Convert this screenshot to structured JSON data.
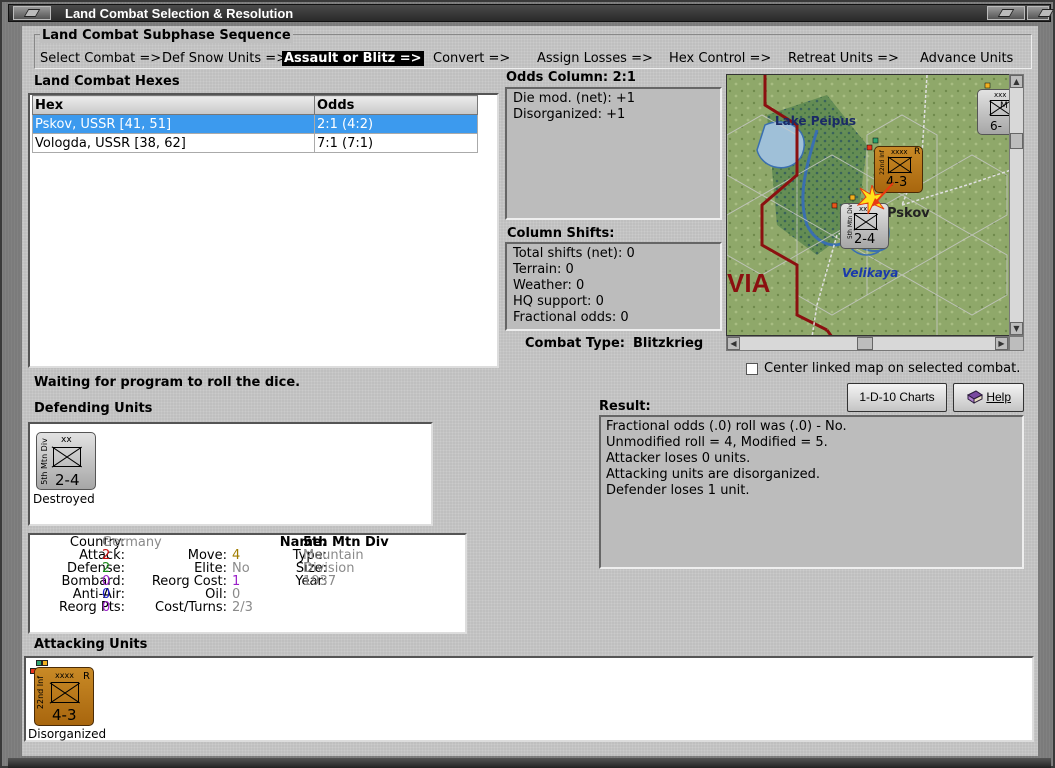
{
  "window": {
    "title": "Land Combat Selection & Resolution"
  },
  "sequence": {
    "title": "Land Combat Subphase Sequence",
    "steps": [
      "Select Combat =>",
      "Def Snow Units =>",
      "Assault or Blitz =>",
      "Convert =>",
      "Assign Losses =>",
      "Hex Control =>",
      "Retreat Units =>",
      "Advance Units"
    ],
    "active_index": 2
  },
  "hexes": {
    "title": "Land Combat Hexes",
    "columns": [
      "Hex",
      "Odds"
    ],
    "rows": [
      {
        "hex": "Pskov, USSR [41, 51]",
        "odds": "2:1 (4:2)",
        "selected": true
      },
      {
        "hex": "Vologda, USSR [38, 62]",
        "odds": "7:1 (7:1)",
        "selected": false
      }
    ]
  },
  "odds": {
    "title": "Odds Column: 2:1",
    "lines": [
      "Die mod. (net): +1",
      "Disorganized: +1"
    ]
  },
  "shifts": {
    "title": "Column Shifts:",
    "lines": [
      "Total shifts (net): 0",
      "Terrain: 0",
      "Weather: 0",
      "HQ support: 0",
      "Fractional odds: 0"
    ]
  },
  "combat_type": {
    "label": "Combat Type:",
    "value": "Blitzkrieg"
  },
  "map": {
    "labels": {
      "lake": "Lake Peipus",
      "city": "Pskov",
      "river": "Velikaya",
      "region": "VIA"
    },
    "counters": {
      "defender": {
        "size": "xx",
        "unit": "5th Mtn Div",
        "strength": "2-4"
      },
      "attacker": {
        "size": "xxxx",
        "unit": "22nd Inf",
        "flag": "R",
        "strength": "4-3"
      },
      "offmap": {
        "size": "xxx",
        "code": "M",
        "strength": "6-"
      }
    }
  },
  "center_linked": {
    "label": "Center linked map on selected combat.",
    "checked": false
  },
  "buttons": {
    "charts": "1-D-10 Charts",
    "help": "Help"
  },
  "status": "Waiting for program to roll the dice.",
  "defending": {
    "title": "Defending Units",
    "unit": {
      "size": "xx",
      "name": "5th Mtn Div",
      "strength": "2-4",
      "status": "Destroyed"
    }
  },
  "result": {
    "title": "Result:",
    "lines": [
      "Fractional odds (.0) roll was (.0)  - No.",
      "Unmodified roll = 4, Modified = 5.",
      "Attacker loses 0 units.",
      "Attacking units are disorganized.",
      "Defender loses 1 unit."
    ]
  },
  "details": {
    "country": {
      "label": "Country:",
      "value": "Germany"
    },
    "attack": {
      "label": "Attack:",
      "value": "2"
    },
    "defense": {
      "label": "Defense:",
      "value": "2"
    },
    "bombard": {
      "label": "Bombard:",
      "value": "0"
    },
    "antiair": {
      "label": "Anti-Air:",
      "value": "0"
    },
    "reorgpts": {
      "label": "Reorg Pts:",
      "value": "0"
    },
    "move": {
      "label": "Move:",
      "value": "4"
    },
    "elite": {
      "label": "Elite:",
      "value": "No"
    },
    "reorgcost": {
      "label": "Reorg Cost:",
      "value": "1"
    },
    "oil": {
      "label": "Oil:",
      "value": "0"
    },
    "costturns": {
      "label": "Cost/Turns:",
      "value": "2/3"
    },
    "name": {
      "label": "Name:",
      "value": "5th Mtn Div"
    },
    "type": {
      "label": "Type:",
      "value": "Mountain"
    },
    "size": {
      "label": "Size:",
      "value": "Division"
    },
    "year": {
      "label": "Year:",
      "value": "1937"
    }
  },
  "attacking": {
    "title": "Attacking Units",
    "unit": {
      "size": "xxxx",
      "name": "22nd Inf",
      "flag": "R",
      "strength": "4-3",
      "status": "Disorganized"
    }
  },
  "colors": {
    "selection": "#3c9aee",
    "german_counter": "#b9b9b9",
    "soviet_counter": "#b87417",
    "border_red": "#8b1010"
  }
}
